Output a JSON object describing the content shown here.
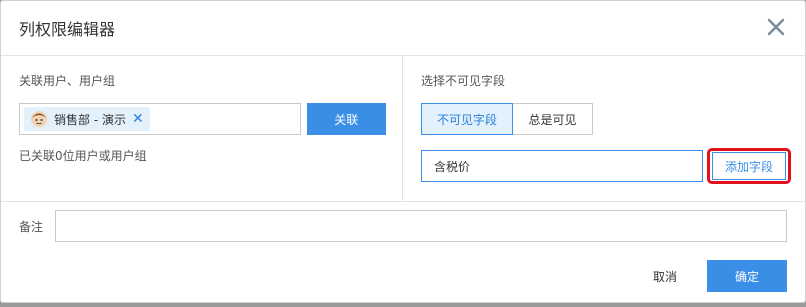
{
  "dialog": {
    "title": "列权限编辑器"
  },
  "left": {
    "label": "关联用户、用户组",
    "tags": [
      {
        "label": "销售部 - 演示",
        "icon": "user-avatar-icon"
      }
    ],
    "associate_button": "关联",
    "hint": "已关联0位用户或用户组"
  },
  "right": {
    "label": "选择不可见字段",
    "segments": [
      {
        "label": "不可见字段",
        "active": true
      },
      {
        "label": "总是可见",
        "active": false
      }
    ],
    "field_value": "含税价",
    "add_button": "添加字段"
  },
  "note": {
    "label": "备注",
    "value": ""
  },
  "footer": {
    "cancel": "取消",
    "confirm": "确定"
  },
  "colors": {
    "primary": "#3a8ee6",
    "highlight": "#e0111a",
    "tag_bg": "#e3f1fc"
  }
}
